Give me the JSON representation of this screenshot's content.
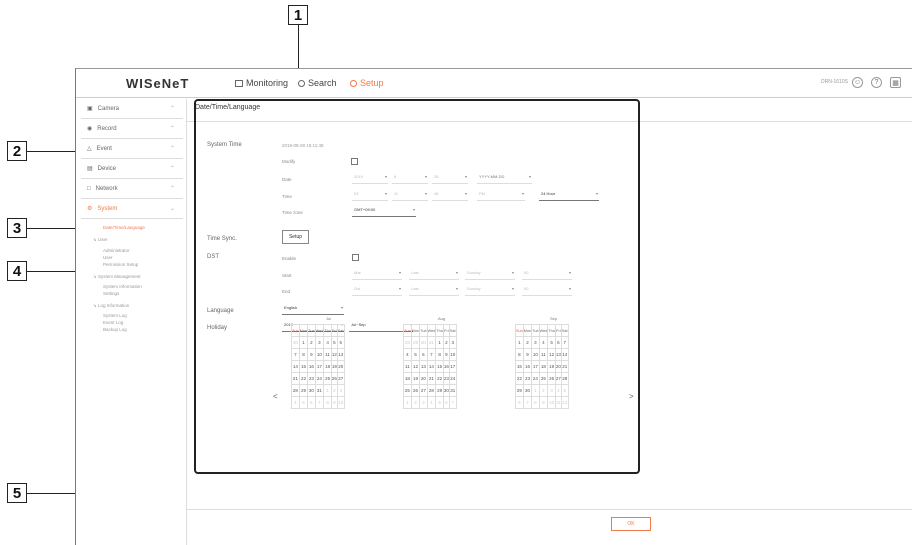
{
  "callouts": [
    "1",
    "2",
    "3",
    "4",
    "5"
  ],
  "app": {
    "logo": "WISeNeT",
    "menu": [
      {
        "label": "Monitoring",
        "icon": "monitor-icon"
      },
      {
        "label": "Search",
        "icon": "search-icon"
      },
      {
        "label": "Setup",
        "icon": "gear-icon"
      }
    ],
    "device_name": "DRN-1610S",
    "accent_color": "#ef7a4b"
  },
  "sidebar": {
    "items": [
      {
        "label": "Camera",
        "icon": "camera-icon"
      },
      {
        "label": "Record",
        "icon": "record-icon"
      },
      {
        "label": "Event",
        "icon": "bell-icon"
      },
      {
        "label": "Device",
        "icon": "device-icon"
      },
      {
        "label": "Network",
        "icon": "network-icon"
      },
      {
        "label": "System",
        "icon": "gear-icon"
      }
    ],
    "system_sub": {
      "date_time_language": "Date/Time/Language",
      "user": "User",
      "administrator": "Administrator",
      "user_item": "User",
      "permission_setup": "Permission Setup",
      "system_management": "System Management",
      "system_information": "System Information",
      "settings": "Settings",
      "log_information": "Log Information",
      "system_log": "System Log",
      "event_log": "Event Log",
      "backup_log": "Backup Log"
    }
  },
  "page": {
    "tab": "Date/Time/Language",
    "system_time_label": "System Time",
    "system_time_value": "2019-08-28 15:11:48",
    "modify_label": "Modify",
    "date_label": "Date",
    "date_year": "2019",
    "date_month": "8",
    "date_day": "28",
    "date_format": "YYYY-MM-DD",
    "time_label": "Time",
    "time_hour": "03",
    "time_minute": "11",
    "time_second": "48",
    "time_ampm": "PM",
    "time_format": "24 Hour",
    "time_zone_label": "Time zone",
    "time_zone_value": "GMT+09:00",
    "time_sync_label": "Time Sync.",
    "setup_button": "Setup",
    "dst_label": "DST",
    "enable_label": "Enable",
    "start_label": "Start",
    "end_label": "End",
    "dst_start": [
      "Mar",
      "Last",
      "Sunday",
      "00"
    ],
    "dst_end": [
      "Oct",
      "Last",
      "Sunday",
      "00"
    ],
    "language_label": "Language",
    "language_value": "English",
    "holiday_label": "Holiday",
    "holiday_year": "2019",
    "holiday_range": "Jul~Sep",
    "ok_button": "OK"
  },
  "calendar": {
    "weekdays": [
      "Sun",
      "Mon",
      "Tue",
      "Wed",
      "Thu",
      "Fri",
      "Sat"
    ],
    "prev_icon": "<",
    "next_icon": ">",
    "months": [
      {
        "name": "Jul",
        "weeks": [
          [
            "30",
            "1",
            "2",
            "3",
            "4",
            "5",
            "6"
          ],
          [
            "7",
            "8",
            "9",
            "10",
            "11",
            "12",
            "13"
          ],
          [
            "14",
            "15",
            "16",
            "17",
            "18",
            "19",
            "20"
          ],
          [
            "21",
            "22",
            "23",
            "24",
            "25",
            "26",
            "27"
          ],
          [
            "28",
            "29",
            "30",
            "31",
            "1",
            "2",
            "3"
          ],
          [
            "4",
            "5",
            "6",
            "7",
            "8",
            "9",
            "10"
          ]
        ],
        "dim": [
          [
            0,
            0
          ],
          [
            4,
            4
          ],
          [
            4,
            5
          ],
          [
            4,
            6
          ],
          [
            5,
            0
          ],
          [
            5,
            1
          ],
          [
            5,
            2
          ],
          [
            5,
            3
          ],
          [
            5,
            4
          ],
          [
            5,
            5
          ],
          [
            5,
            6
          ]
        ]
      },
      {
        "name": "Aug",
        "weeks": [
          [
            "28",
            "29",
            "30",
            "31",
            "1",
            "2",
            "3"
          ],
          [
            "4",
            "5",
            "6",
            "7",
            "8",
            "9",
            "10"
          ],
          [
            "11",
            "12",
            "13",
            "14",
            "15",
            "16",
            "17"
          ],
          [
            "18",
            "19",
            "20",
            "21",
            "22",
            "23",
            "24"
          ],
          [
            "25",
            "26",
            "27",
            "28",
            "29",
            "30",
            "31"
          ],
          [
            "1",
            "2",
            "3",
            "4",
            "5",
            "6",
            "7"
          ]
        ],
        "dim": [
          [
            0,
            0
          ],
          [
            0,
            1
          ],
          [
            0,
            2
          ],
          [
            0,
            3
          ],
          [
            5,
            0
          ],
          [
            5,
            1
          ],
          [
            5,
            2
          ],
          [
            5,
            3
          ],
          [
            5,
            4
          ],
          [
            5,
            5
          ],
          [
            5,
            6
          ]
        ]
      },
      {
        "name": "Sep",
        "weeks": [
          [
            "1",
            "2",
            "3",
            "4",
            "5",
            "6",
            "7"
          ],
          [
            "8",
            "9",
            "10",
            "11",
            "12",
            "13",
            "14"
          ],
          [
            "15",
            "16",
            "17",
            "18",
            "19",
            "20",
            "21"
          ],
          [
            "22",
            "23",
            "24",
            "25",
            "26",
            "27",
            "28"
          ],
          [
            "29",
            "30",
            "1",
            "2",
            "3",
            "4",
            "5"
          ],
          [
            "6",
            "7",
            "8",
            "9",
            "10",
            "11",
            "12"
          ]
        ],
        "dim": [
          [
            4,
            2
          ],
          [
            4,
            3
          ],
          [
            4,
            4
          ],
          [
            4,
            5
          ],
          [
            4,
            6
          ],
          [
            5,
            0
          ],
          [
            5,
            1
          ],
          [
            5,
            2
          ],
          [
            5,
            3
          ],
          [
            5,
            4
          ],
          [
            5,
            5
          ],
          [
            5,
            6
          ]
        ]
      }
    ]
  }
}
